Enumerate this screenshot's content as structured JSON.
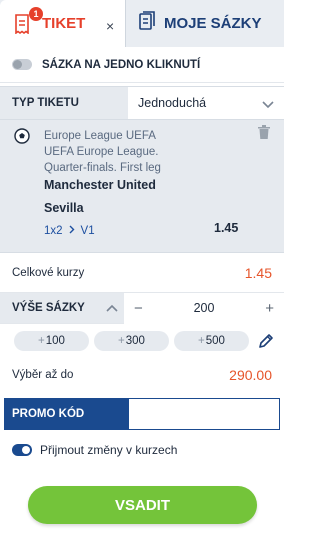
{
  "tabs": {
    "ticket_label": "TIKET",
    "ticket_badge": "1",
    "close_symbol": "×",
    "my_bets_label": "MOJE SÁZKY"
  },
  "single_click": {
    "label": "SÁZKA NA JEDNO KLIKNUTÍ"
  },
  "ticket_type": {
    "label": "TYP TIKETU",
    "selected": "Jednoduchá"
  },
  "bet": {
    "league_line1": "Europe League UEFA",
    "league_line2": "UEFA Europe League.",
    "league_line3": "Quarter-finals. First leg",
    "team1": "Manchester United",
    "team2": "Sevilla",
    "market": "1x2",
    "selection": "V1",
    "odd": "1.45"
  },
  "total_odds": {
    "label": "Celkové kurzy",
    "value": "1.45"
  },
  "stake": {
    "label": "VÝŠE SÁZKY",
    "minus": "−",
    "amount": "200",
    "plus": "+"
  },
  "quick_amounts": [
    {
      "plus": "+",
      "value": "100"
    },
    {
      "plus": "+",
      "value": "300"
    },
    {
      "plus": "+",
      "value": "500"
    }
  ],
  "payout": {
    "label": "Výběr až do",
    "value": "290.00"
  },
  "promo": {
    "label": "PROMO KÓD",
    "placeholder": ""
  },
  "accept_changes": {
    "label": "Přijmout změny v kurzech"
  },
  "submit": {
    "label": "VSADIT"
  },
  "colors": {
    "accent_red": "#e6402b",
    "brand_blue": "#1a4a8f",
    "submit_green": "#74c43a"
  }
}
